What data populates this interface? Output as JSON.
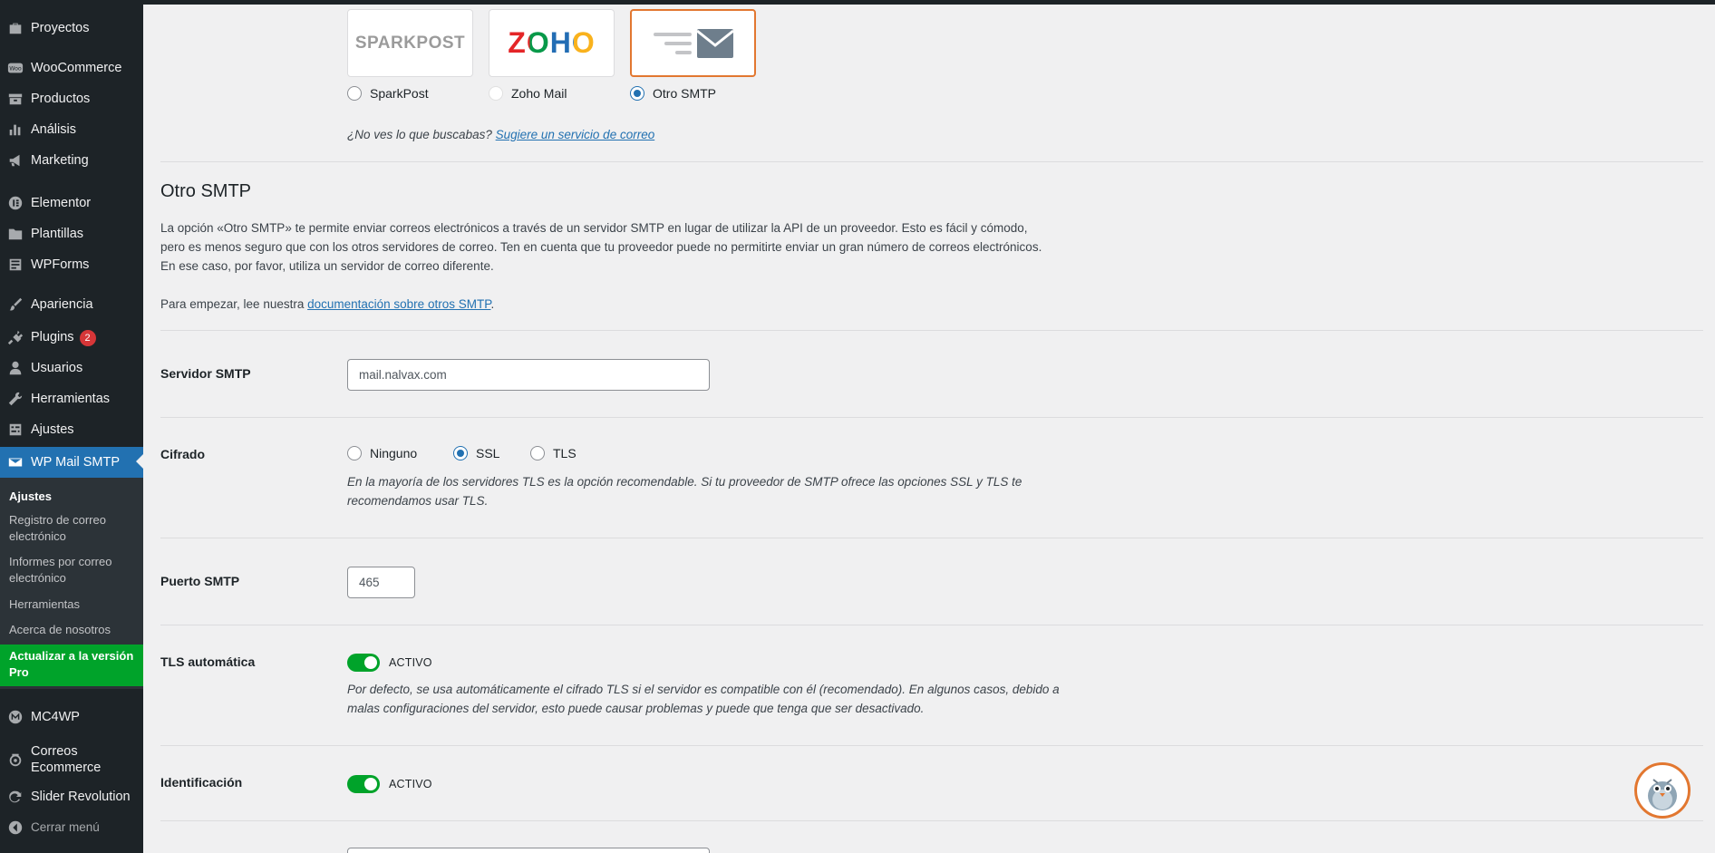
{
  "sidebar": {
    "items": [
      {
        "label": "Proyectos",
        "icon": "briefcase-icon"
      },
      {
        "label": "WooCommerce",
        "icon": "woocommerce-icon"
      },
      {
        "label": "Productos",
        "icon": "archive-icon"
      },
      {
        "label": "Análisis",
        "icon": "bar-chart-icon"
      },
      {
        "label": "Marketing",
        "icon": "megaphone-icon"
      },
      {
        "label": "Elementor",
        "icon": "elementor-icon"
      },
      {
        "label": "Plantillas",
        "icon": "folder-icon"
      },
      {
        "label": "WPForms",
        "icon": "form-icon"
      },
      {
        "label": "Apariencia",
        "icon": "paintbrush-icon"
      },
      {
        "label": "Plugins",
        "icon": "plug-icon",
        "badge": "2"
      },
      {
        "label": "Usuarios",
        "icon": "user-icon"
      },
      {
        "label": "Herramientas",
        "icon": "wrench-icon"
      },
      {
        "label": "Ajustes",
        "icon": "settings-icon"
      },
      {
        "label": "WP Mail SMTP",
        "icon": "mail-icon",
        "active": true
      },
      {
        "label": "MC4WP",
        "icon": "mc4wp-icon"
      },
      {
        "label": "Correos Ecommerce",
        "icon": "post-horn-icon"
      },
      {
        "label": "Slider Revolution",
        "icon": "refresh-icon"
      }
    ],
    "submenu": [
      {
        "label": "Ajustes",
        "current": true
      },
      {
        "label": "Registro de correo electrónico"
      },
      {
        "label": "Informes por correo electrónico"
      },
      {
        "label": "Herramientas"
      },
      {
        "label": "Acerca de nosotros"
      }
    ],
    "upgrade_label": "Actualizar a la versión Pro",
    "collapse_label": "Cerrar menú"
  },
  "providers": {
    "options": [
      {
        "label": "SparkPost",
        "logo_text": "SPARKPOST",
        "state": "unchecked"
      },
      {
        "label": "Zoho Mail",
        "logo_text": "ZOHO",
        "state": "disabled"
      },
      {
        "label": "Otro SMTP",
        "state": "checked"
      }
    ],
    "suggest_prefix": "¿No ves lo que buscabas?",
    "suggest_link": "Sugiere un servicio de correo"
  },
  "other_smtp": {
    "title": "Otro SMTP",
    "description_lines": [
      "La opción «Otro SMTP» te permite enviar correos electrónicos a través de un servidor SMTP en lugar de utilizar la API de un proveedor. Esto es fácil y cómodo,",
      "pero es menos seguro que con los otros servidores de correo. Ten en cuenta que tu proveedor puede no permitirte enviar un gran número de correos electrónicos.",
      "En ese caso, por favor, utiliza un servidor de correo diferente."
    ],
    "docs_prefix": "Para empezar, lee nuestra",
    "docs_link": "documentación sobre otros SMTP",
    "docs_suffix": "."
  },
  "fields": {
    "smtp_host": {
      "label": "Servidor SMTP",
      "value": "mail.nalvax.com"
    },
    "encryption": {
      "label": "Cifrado",
      "options": [
        {
          "label": "Ninguno",
          "checked": false
        },
        {
          "label": "SSL",
          "checked": true
        },
        {
          "label": "TLS",
          "checked": false
        }
      ],
      "note_lines": [
        "En la mayoría de los servidores TLS es la opción recomendable. Si tu proveedor de SMTP ofrece las opciones SSL y TLS te",
        "recomendamos usar TLS."
      ]
    },
    "smtp_port": {
      "label": "Puerto SMTP",
      "value": "465"
    },
    "auto_tls": {
      "label": "TLS automática",
      "toggle_label": "ACTIVO",
      "note_lines": [
        "Por defecto, se usa automáticamente el cifrado TLS si el servidor es compatible con él (recomendado). En algunos casos, debido a",
        "malas configuraciones del servidor, esto puede causar problemas y puede que tenga que ser desactivado."
      ]
    },
    "authentication": {
      "label": "Identificación",
      "toggle_label": "ACTIVO"
    }
  },
  "colors": {
    "accent": "#2271b1",
    "active_menu": "#2271b1",
    "upgrade": "#00a32a",
    "toggle_on": "#00a32a",
    "selected_border": "#e27730",
    "badge": "#d63638"
  }
}
